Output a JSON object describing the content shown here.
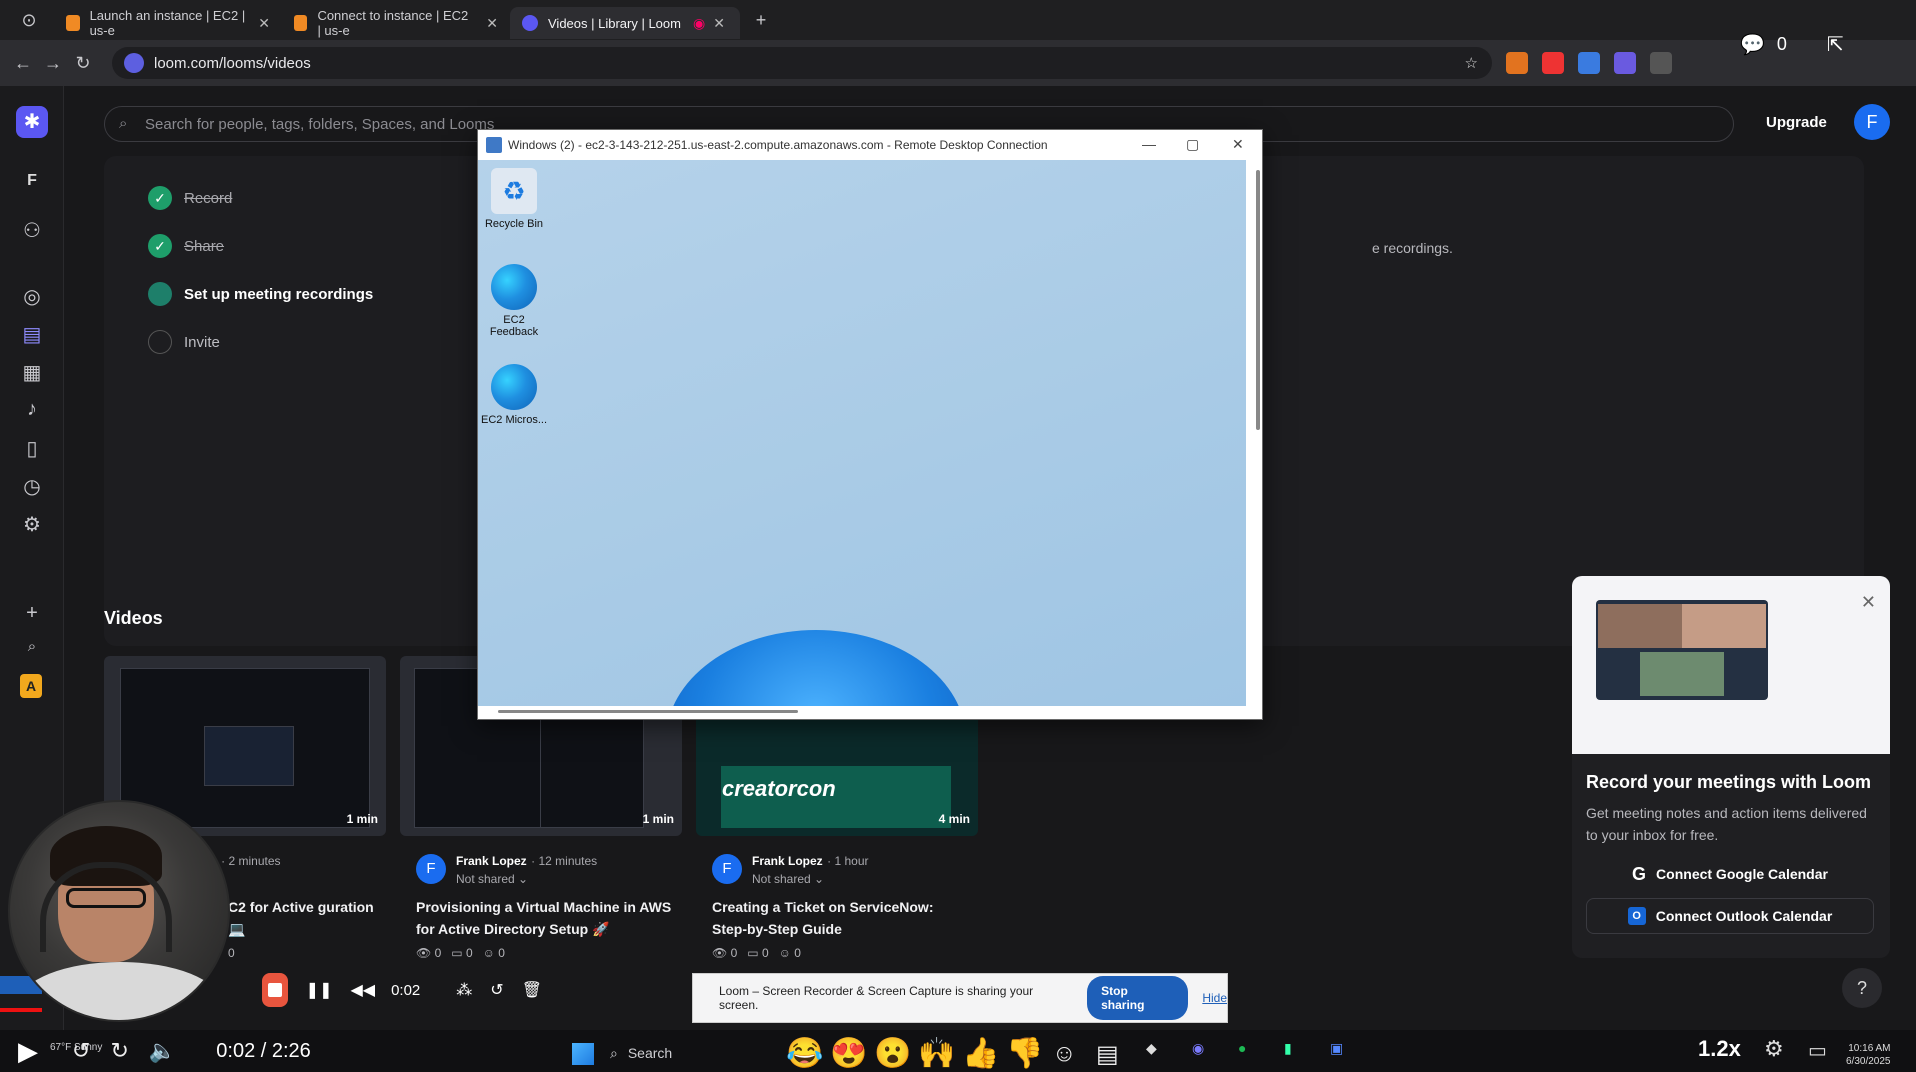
{
  "browser": {
    "tabs": [
      {
        "label": "Launch an instance | EC2 | us-e"
      },
      {
        "label": "Connect to instance | EC2 | us-e"
      },
      {
        "label": "Videos | Library | Loom"
      }
    ],
    "url": "loom.com/looms/videos"
  },
  "loom": {
    "search_placeholder": "Search for people, tags, folders, Spaces, and Looms",
    "upgrade_label": "Upgrade",
    "avatar_initial": "F",
    "rail_initial": "F",
    "rail_badge": "A",
    "checklist": [
      {
        "label": "Record",
        "state": "done"
      },
      {
        "label": "Share",
        "state": "done"
      },
      {
        "label": "Set up meeting recordings",
        "state": "current"
      },
      {
        "label": "Invite",
        "state": "todo"
      }
    ],
    "recordings_note": "e recordings.",
    "videos_heading": "Videos",
    "videos": [
      {
        "duration": "1 min",
        "author": "ez",
        "time": "· 2 minutes",
        "shared": "",
        "title": "C2 for Active guration 💻",
        "stats": {
          "views": "0",
          "comments": "",
          "reactions": ""
        }
      },
      {
        "duration": "1 min",
        "author": "Frank Lopez",
        "time": "· 12 minutes",
        "shared": "Not shared ⌄",
        "title": "Provisioning a Virtual Machine in AWS for Active Directory Setup 🚀",
        "stats": {
          "views": "0",
          "comments": "0",
          "reactions": "0"
        }
      },
      {
        "duration": "4 min",
        "author": "Frank Lopez",
        "time": "· 1 hour",
        "shared": "Not shared ⌄",
        "title": "Creating a Ticket on ServiceNow: Step-by-Step Guide",
        "stats": {
          "views": "0",
          "comments": "0",
          "reactions": "0"
        }
      }
    ],
    "video_initial": "F",
    "thumb_brand": "creatorcon",
    "promo": {
      "title": "Record your meetings with Loom",
      "body": "Get meeting notes and action items delivered to your inbox for free.",
      "google_btn": "Connect Google Calendar",
      "outlook_btn": "Connect Outlook Calendar"
    },
    "help_label": "?"
  },
  "rdp": {
    "title": "Windows (2) - ec2-3-143-212-251.us-east-2.compute.amazonaws.com - Remote Desktop Connection",
    "icons": [
      {
        "label": "Recycle Bin"
      },
      {
        "label": "EC2 Feedback"
      },
      {
        "label": "EC2 Micros..."
      }
    ]
  },
  "recorder": {
    "time": "0:02"
  },
  "share_bar": {
    "message": "Loom – Screen Recorder & Screen Capture is sharing your screen.",
    "stop_label": "Stop sharing",
    "hide_label": "Hide"
  },
  "player": {
    "time": "0:02 / 2:26",
    "zoom": "1.2x",
    "chat_count": "0"
  },
  "taskbar": {
    "weather": "67°F Sunny",
    "search": "Search",
    "date": "6/30/2025",
    "time": "10:16 AM"
  },
  "colors": {
    "loom_brand": "#5b57f2",
    "avatar_blue": "#1a6cf0",
    "check_green": "#1e9e6a",
    "record_red": "#e8553e",
    "stop_sharing_blue": "#1e5fb8"
  }
}
